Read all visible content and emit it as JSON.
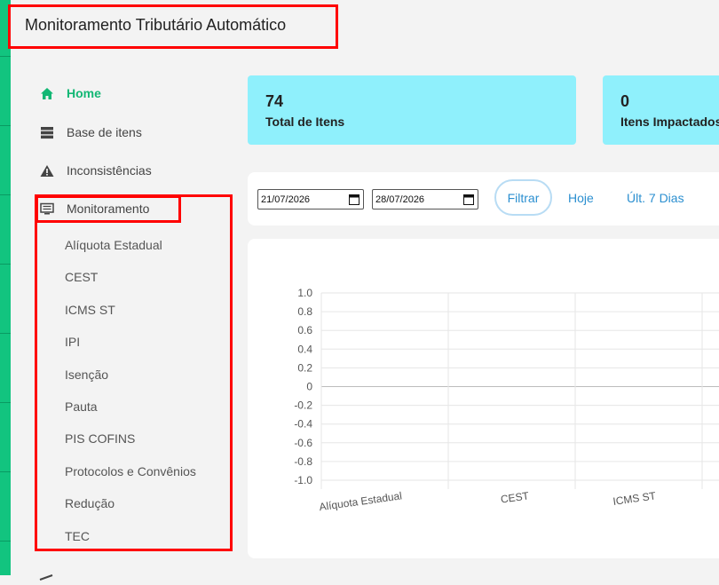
{
  "app": {
    "title": "Monitoramento Tributário Automático"
  },
  "sidebar": {
    "items": [
      {
        "label": "Home",
        "icon": "home-icon",
        "active": true
      },
      {
        "label": "Base de itens",
        "icon": "database-icon"
      },
      {
        "label": "Inconsistências",
        "icon": "warning-icon"
      },
      {
        "label": "Monitoramento",
        "icon": "monitor-icon"
      }
    ],
    "submenu": [
      "Alíquota Estadual",
      "CEST",
      "ICMS ST",
      "IPI",
      "Isenção",
      "Pauta",
      "PIS COFINS",
      "Protocolos e Convênios",
      "Redução",
      "TEC"
    ]
  },
  "cards": [
    {
      "value": "74",
      "label": "Total de Itens"
    },
    {
      "value": "0",
      "label": "Itens Impactados"
    }
  ],
  "filter": {
    "date_from": "21/07/2026",
    "date_to": "28/07/2026",
    "filter_label": "Filtrar",
    "today_label": "Hoje",
    "last7_label": "Últ. 7 Dias"
  },
  "colors": {
    "accent": "#12b774",
    "card": "#8ff0fc",
    "link": "#2b8fd0",
    "highlight": "#ff0000"
  },
  "chart_data": {
    "type": "bar",
    "categories": [
      "Alíquota Estadual",
      "CEST",
      "ICMS ST"
    ],
    "values": [
      0,
      0,
      0
    ],
    "ylim": [
      -1.0,
      1.0
    ],
    "yticks": [
      "1.0",
      "0.8",
      "0.6",
      "0.4",
      "0.2",
      "0",
      "-0.2",
      "-0.4",
      "-0.6",
      "-0.8",
      "-1.0"
    ],
    "grid": true
  }
}
